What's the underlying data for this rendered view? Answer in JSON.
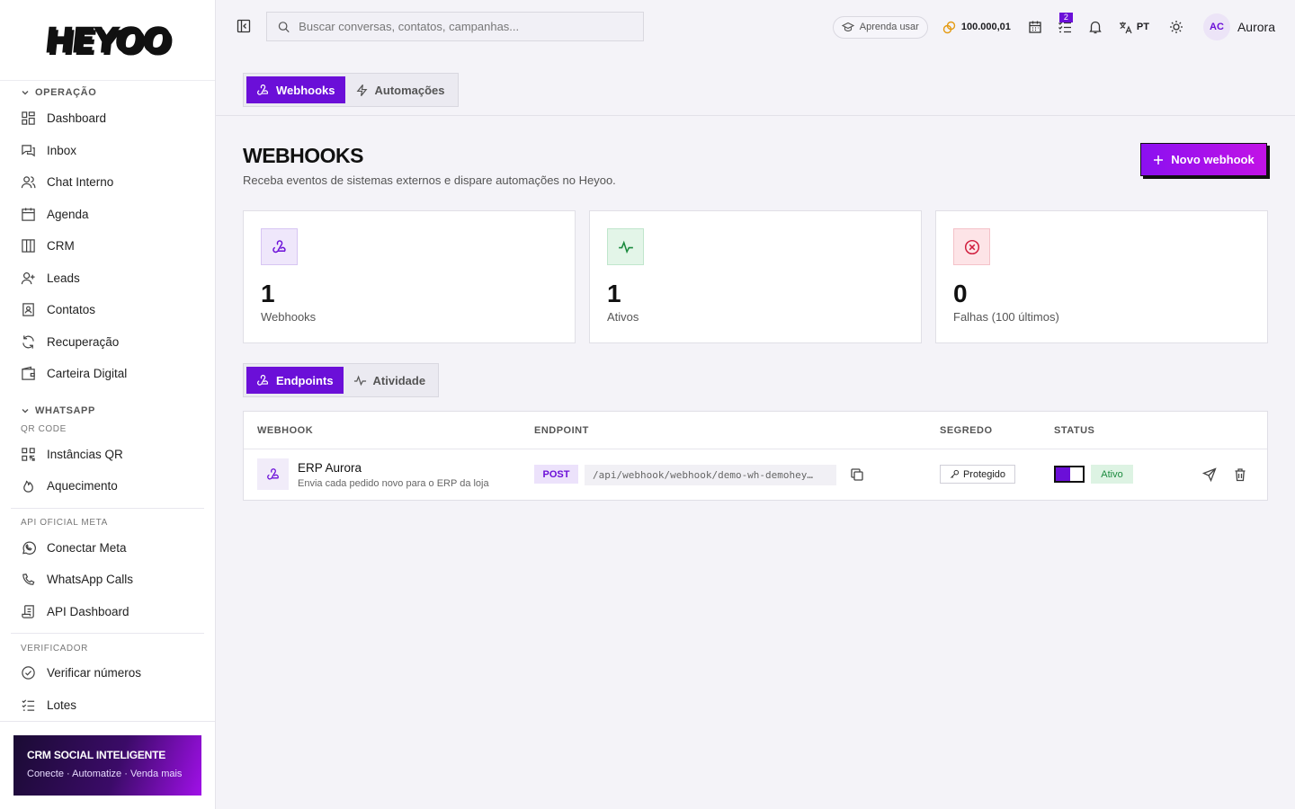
{
  "app": {
    "logo_text": "HEYOO"
  },
  "sidebar": {
    "sections": [
      {
        "title": "OPERAÇÃO",
        "items": [
          "Dashboard",
          "Inbox",
          "Chat Interno",
          "Agenda",
          "CRM",
          "Leads",
          "Contatos",
          "Recuperação",
          "Carteira Digital"
        ]
      },
      {
        "title": "WHATSAPP",
        "subtitle": "QR CODE",
        "items": [
          "Instâncias QR",
          "Aquecimento"
        ]
      },
      {
        "title": "API OFICIAL META",
        "items": [
          "Conectar Meta",
          "WhatsApp Calls",
          "API Dashboard"
        ]
      },
      {
        "title": "VERIFICADOR",
        "items": [
          "Verificar números",
          "Lotes"
        ]
      }
    ],
    "promo": {
      "title": "CRM SOCIAL INTELIGENTE",
      "subtitle": "Conecte · Automatize · Venda mais"
    }
  },
  "topbar": {
    "search_placeholder": "Buscar conversas, contatos, campanhas...",
    "learn_label": "Aprenda usar",
    "coins": "100.000,01",
    "tasks_badge": "2",
    "language": "PT",
    "user_initials": "AC",
    "user_name": "Aurora"
  },
  "top_tabs": [
    "Webhooks",
    "Automações"
  ],
  "page": {
    "title": "WEBHOOKS",
    "subtitle": "Receba eventos de sistemas externos e dispare automações no Heyoo.",
    "new_button": "Novo webhook"
  },
  "stats": [
    {
      "value": "1",
      "label": "Webhooks"
    },
    {
      "value": "1",
      "label": "Ativos"
    },
    {
      "value": "0",
      "label": "Falhas (100 últimos)"
    }
  ],
  "sub_tabs": [
    "Endpoints",
    "Atividade"
  ],
  "table": {
    "headers": [
      "WEBHOOK",
      "ENDPOINT",
      "SEGREDO",
      "STATUS"
    ],
    "rows": [
      {
        "name": "ERP Aurora",
        "description": "Envia cada pedido novo para o ERP da loja",
        "method": "POST",
        "endpoint": "/api/webhook/webhook/demo-wh-demohey…",
        "secret": "Protegido",
        "status": "Ativo",
        "active": true
      }
    ]
  },
  "colors": {
    "accent": "#6b0fd8",
    "success": "#1b8a3e",
    "danger": "#d01c3c"
  }
}
